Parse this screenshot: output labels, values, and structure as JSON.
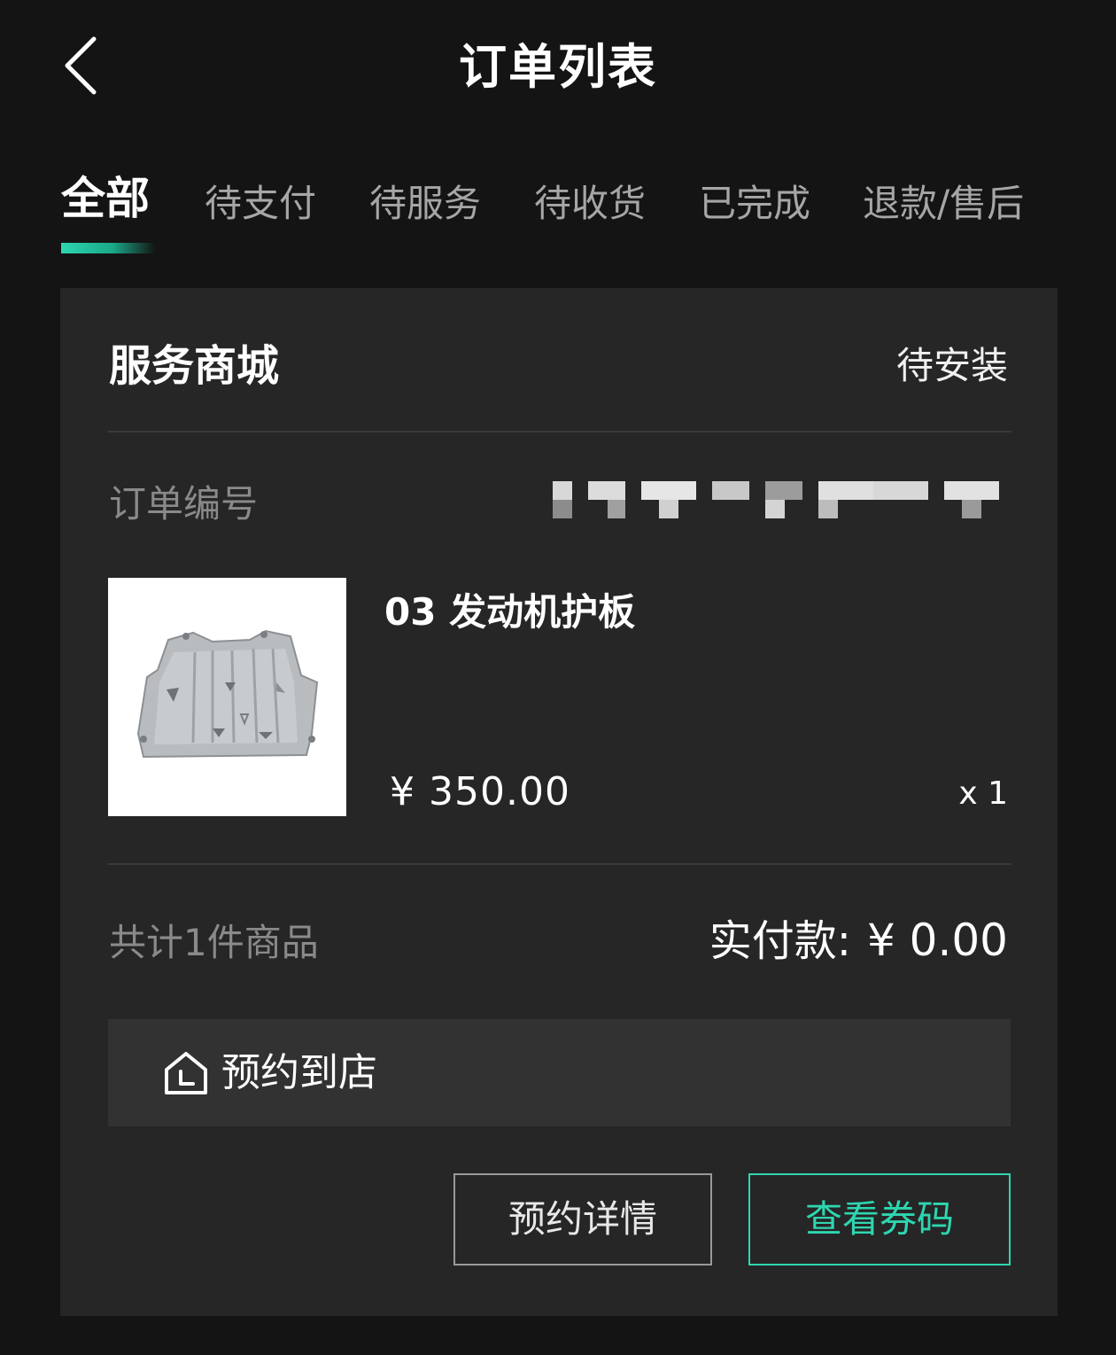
{
  "header": {
    "title": "订单列表",
    "back_icon": "chevron-left-icon"
  },
  "tabs": [
    {
      "label": "全部",
      "active": true
    },
    {
      "label": "待支付",
      "active": false
    },
    {
      "label": "待服务",
      "active": false
    },
    {
      "label": "待收货",
      "active": false
    },
    {
      "label": "已完成",
      "active": false
    },
    {
      "label": "退款/售后",
      "active": false
    }
  ],
  "order": {
    "store_name": "服务商城",
    "status": "待安装",
    "order_no_label": "订单编号",
    "order_no_value": "",
    "product": {
      "name": "03 发动机护板",
      "price": "¥ 350.00",
      "quantity": "x 1",
      "image": "engine-skid-plate"
    },
    "summary": {
      "count_text": "共计1件商品",
      "paid_label": "实付款:",
      "paid_amount": "¥ 0.00"
    },
    "reserve": {
      "label": "预约到店",
      "icon": "store-home-icon"
    },
    "buttons": {
      "detail": "预约详情",
      "coupon": "查看券码"
    }
  },
  "colors": {
    "background": "#141414",
    "card": "#262626",
    "accent": "#2ed6b0",
    "muted_text": "#8a8a8a"
  }
}
